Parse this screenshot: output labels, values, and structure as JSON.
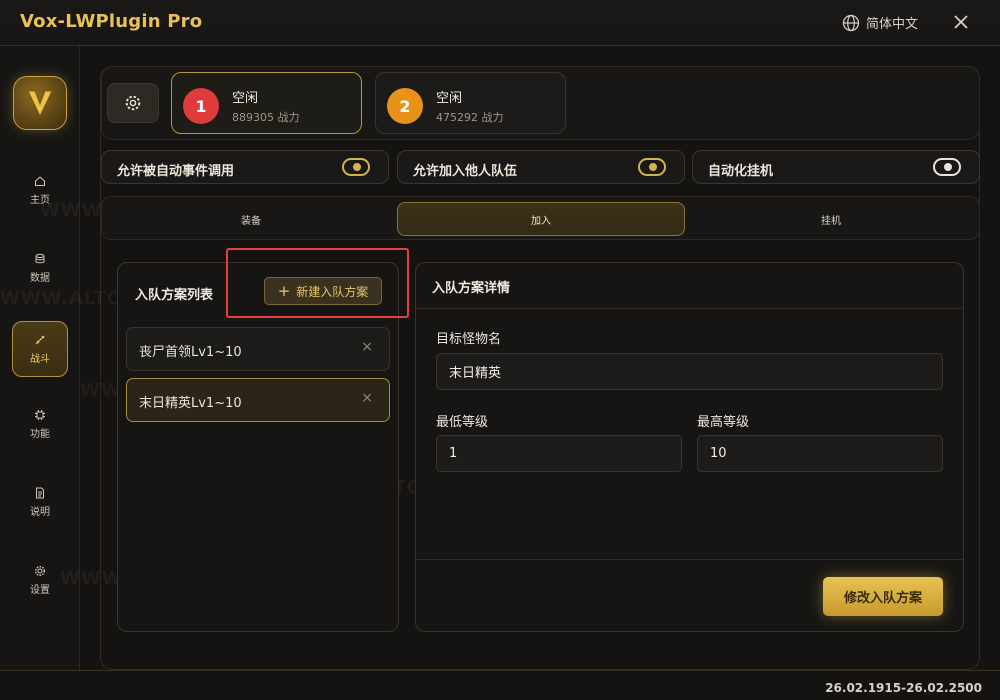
{
  "app": {
    "title": "Vox-LWPlugin Pro",
    "language": "简体中文",
    "version": "26.02.1915-26.02.2500"
  },
  "watermark": "WWW.ALTCHEATS.COM",
  "sidebar": {
    "items": [
      {
        "label": "主页",
        "icon": "home-icon"
      },
      {
        "label": "数据",
        "icon": "database-icon"
      },
      {
        "label": "战斗",
        "icon": "sword-icon",
        "active": true
      },
      {
        "label": "功能",
        "icon": "chip-icon"
      },
      {
        "label": "说明",
        "icon": "document-icon"
      },
      {
        "label": "设置",
        "icon": "gear-icon"
      }
    ]
  },
  "characters": [
    {
      "num": "1",
      "status": "空闲",
      "power": "889305 战力",
      "color": "#e03b3b"
    },
    {
      "num": "2",
      "status": "空闲",
      "power": "475292 战力",
      "color": "#e8921a"
    }
  ],
  "toggles": [
    {
      "label": "允许被自动事件调用",
      "on": true
    },
    {
      "label": "允许加入他人队伍",
      "on": true
    },
    {
      "label": "自动化挂机",
      "on": false
    }
  ],
  "tabs": [
    {
      "label": "装备"
    },
    {
      "label": "加入",
      "active": true
    },
    {
      "label": "挂机"
    }
  ],
  "list": {
    "title": "入队方案列表",
    "new_button": "新建入队方案",
    "items": [
      {
        "label": "丧尸首领Lv1~10"
      },
      {
        "label": "末日精英Lv1~10",
        "selected": true
      }
    ]
  },
  "detail": {
    "title": "入队方案详情",
    "target_label": "目标怪物名",
    "target_value": "末日精英",
    "min_label": "最低等级",
    "min_value": "1",
    "max_label": "最高等级",
    "max_value": "10",
    "modify_button": "修改入队方案"
  },
  "background_number": "1"
}
